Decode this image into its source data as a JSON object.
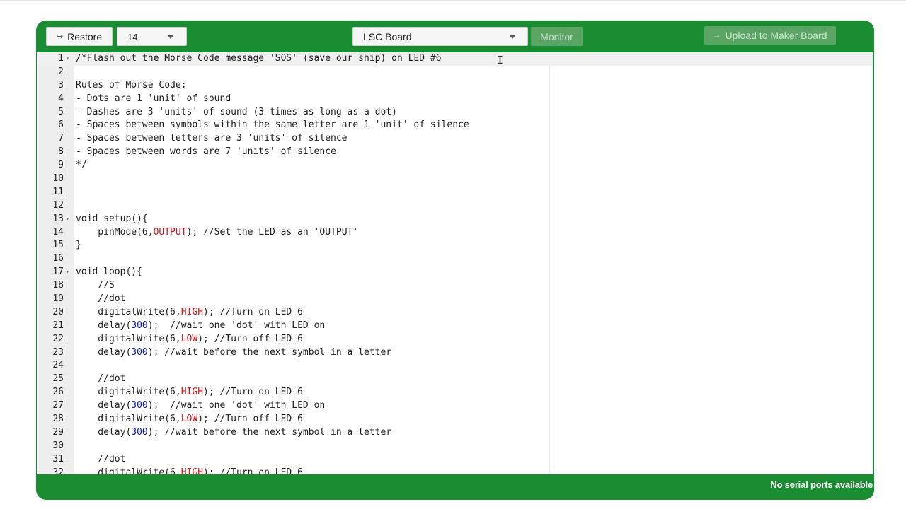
{
  "toolbar": {
    "restore_label": "Restore",
    "restore_icon": "return-arrow-icon",
    "font_size_value": "14",
    "board_value": "LSC Board",
    "monitor_label": "Monitor",
    "upload_label": "Upload to Maker Board",
    "upload_icon": "arrow-right-icon"
  },
  "colors": {
    "frame_green": "#1a8c31",
    "disabled_button": "#5aa564",
    "number_blue": "#0d1ca6",
    "constant_red": "#d0161b"
  },
  "editor": {
    "lines": [
      {
        "n": "1",
        "fold": true,
        "segs": [
          {
            "t": "/*Flash out the Morse Code message 'SOS' (save our ship) on LED #6",
            "c": ""
          }
        ]
      },
      {
        "n": "2",
        "segs": []
      },
      {
        "n": "3",
        "segs": [
          {
            "t": "Rules of Morse Code:",
            "c": ""
          }
        ]
      },
      {
        "n": "4",
        "segs": [
          {
            "t": "- Dots are 1 'unit' of sound",
            "c": ""
          }
        ]
      },
      {
        "n": "5",
        "segs": [
          {
            "t": "- Dashes are 3 'units' of sound (3 times as long as a dot)",
            "c": ""
          }
        ]
      },
      {
        "n": "6",
        "segs": [
          {
            "t": "- Spaces between symbols within the same letter are 1 'unit' of silence",
            "c": ""
          }
        ]
      },
      {
        "n": "7",
        "segs": [
          {
            "t": "- Spaces between letters are 3 'units' of silence",
            "c": ""
          }
        ]
      },
      {
        "n": "8",
        "segs": [
          {
            "t": "- Spaces between words are 7 'units' of silence",
            "c": ""
          }
        ]
      },
      {
        "n": "9",
        "segs": [
          {
            "t": "*/",
            "c": ""
          }
        ]
      },
      {
        "n": "10",
        "segs": []
      },
      {
        "n": "11",
        "segs": []
      },
      {
        "n": "12",
        "segs": []
      },
      {
        "n": "13",
        "fold": true,
        "segs": [
          {
            "t": "void setup(){",
            "c": ""
          }
        ]
      },
      {
        "n": "14",
        "segs": [
          {
            "t": "    pinMode(6,",
            "c": ""
          },
          {
            "t": "OUTPUT",
            "c": "kw"
          },
          {
            "t": "); //Set the LED as an 'OUTPUT'",
            "c": ""
          }
        ]
      },
      {
        "n": "15",
        "segs": [
          {
            "t": "}",
            "c": ""
          }
        ]
      },
      {
        "n": "16",
        "segs": []
      },
      {
        "n": "17",
        "fold": true,
        "segs": [
          {
            "t": "void loop(){",
            "c": ""
          }
        ]
      },
      {
        "n": "18",
        "segs": [
          {
            "t": "    //S",
            "c": ""
          }
        ]
      },
      {
        "n": "19",
        "segs": [
          {
            "t": "    //dot",
            "c": ""
          }
        ]
      },
      {
        "n": "20",
        "segs": [
          {
            "t": "    digitalWrite(6,",
            "c": ""
          },
          {
            "t": "HIGH",
            "c": "kw"
          },
          {
            "t": "); //Turn on LED 6",
            "c": ""
          }
        ]
      },
      {
        "n": "21",
        "segs": [
          {
            "t": "    delay(",
            "c": ""
          },
          {
            "t": "300",
            "c": "num"
          },
          {
            "t": ");  //wait one 'dot' with LED on",
            "c": ""
          }
        ]
      },
      {
        "n": "22",
        "segs": [
          {
            "t": "    digitalWrite(6,",
            "c": ""
          },
          {
            "t": "LOW",
            "c": "kw"
          },
          {
            "t": "); //Turn off LED 6",
            "c": ""
          }
        ]
      },
      {
        "n": "23",
        "segs": [
          {
            "t": "    delay(",
            "c": ""
          },
          {
            "t": "300",
            "c": "num"
          },
          {
            "t": "); //wait before the next symbol in a letter",
            "c": ""
          }
        ]
      },
      {
        "n": "24",
        "segs": []
      },
      {
        "n": "25",
        "segs": [
          {
            "t": "    //dot",
            "c": ""
          }
        ]
      },
      {
        "n": "26",
        "segs": [
          {
            "t": "    digitalWrite(6,",
            "c": ""
          },
          {
            "t": "HIGH",
            "c": "kw"
          },
          {
            "t": "); //Turn on LED 6",
            "c": ""
          }
        ]
      },
      {
        "n": "27",
        "segs": [
          {
            "t": "    delay(",
            "c": ""
          },
          {
            "t": "300",
            "c": "num"
          },
          {
            "t": ");  //wait one 'dot' with LED on",
            "c": ""
          }
        ]
      },
      {
        "n": "28",
        "segs": [
          {
            "t": "    digitalWrite(6,",
            "c": ""
          },
          {
            "t": "LOW",
            "c": "kw"
          },
          {
            "t": "); //Turn off LED 6",
            "c": ""
          }
        ]
      },
      {
        "n": "29",
        "segs": [
          {
            "t": "    delay(",
            "c": ""
          },
          {
            "t": "300",
            "c": "num"
          },
          {
            "t": "); //wait before the next symbol in a letter",
            "c": ""
          }
        ]
      },
      {
        "n": "30",
        "segs": []
      },
      {
        "n": "31",
        "segs": [
          {
            "t": "    //dot",
            "c": ""
          }
        ]
      },
      {
        "n": "32",
        "segs": [
          {
            "t": "    digitalWrite(6,",
            "c": ""
          },
          {
            "t": "HIGH",
            "c": "kw"
          },
          {
            "t": "); //Turn on LED 6",
            "c": ""
          }
        ]
      }
    ]
  },
  "status": {
    "serial_text": "No serial ports available"
  }
}
